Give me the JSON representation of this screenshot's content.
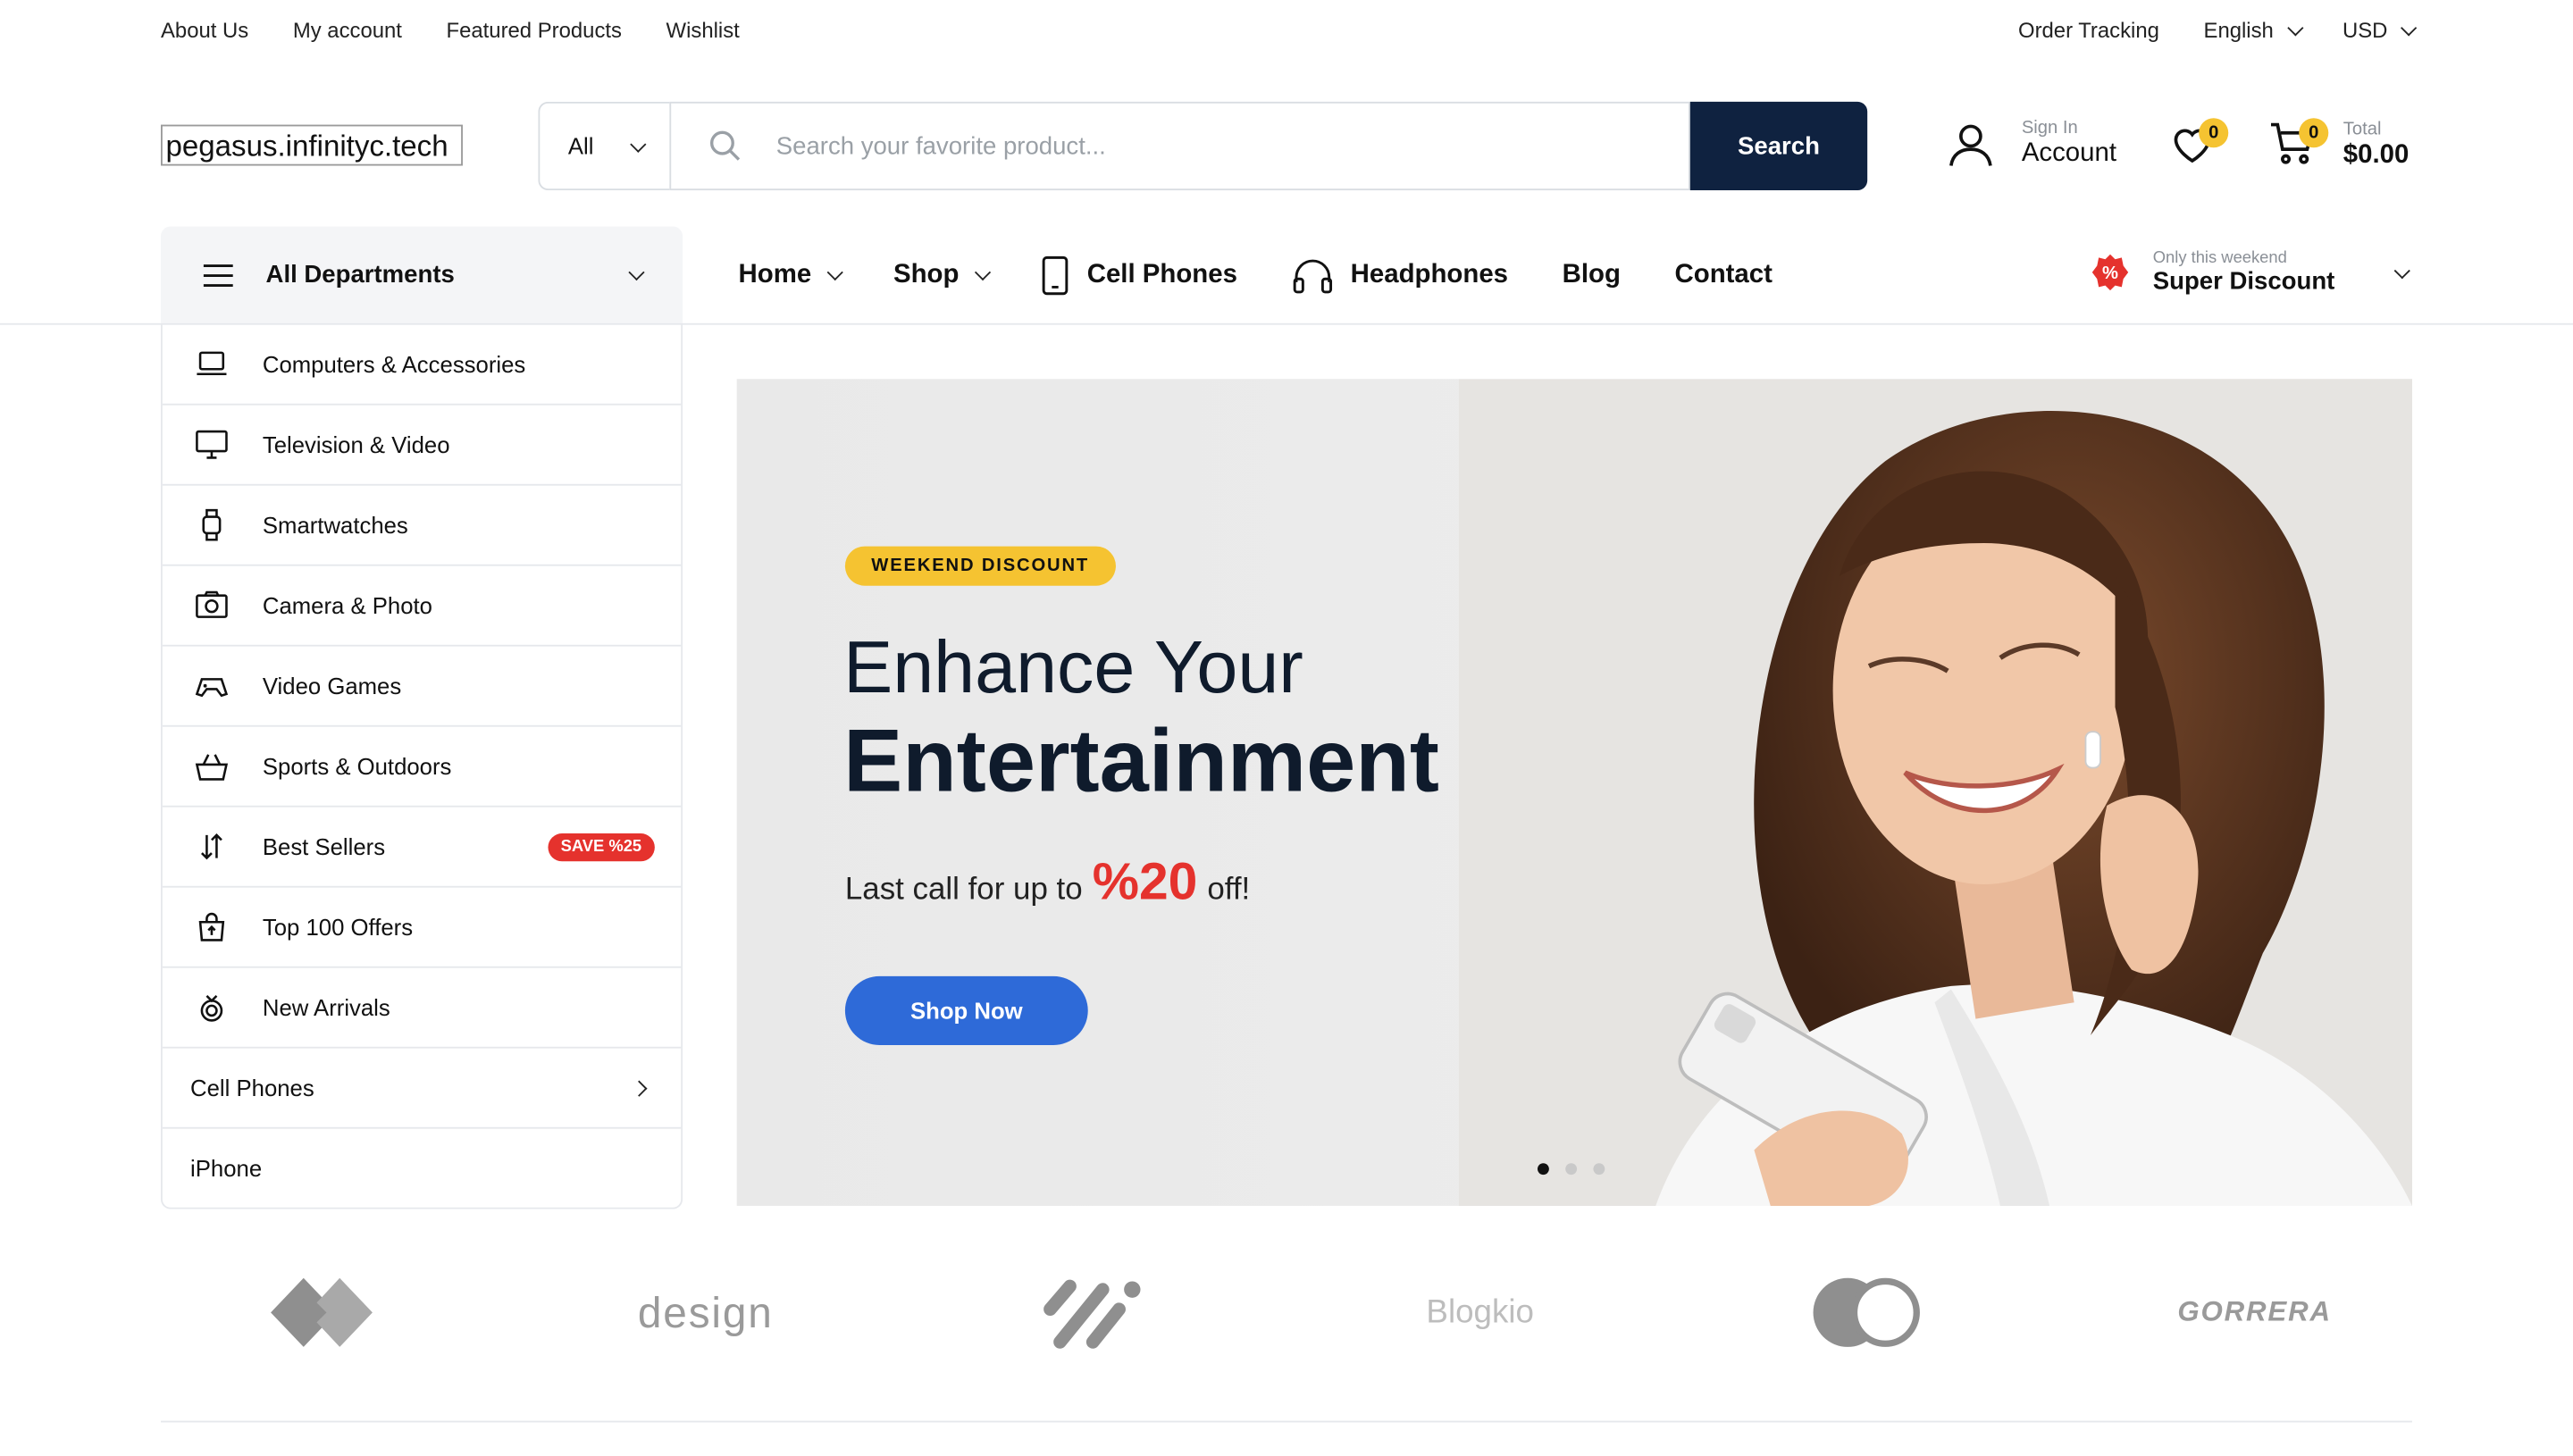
{
  "topbar": {
    "links": [
      "About Us",
      "My account",
      "Featured Products",
      "Wishlist"
    ],
    "order_tracking": "Order Tracking",
    "language": "English",
    "currency": "USD"
  },
  "header": {
    "logo_text": "pegasus.infinityc.tech",
    "search": {
      "category": "All",
      "placeholder": "Search your favorite product...",
      "button": "Search"
    },
    "account": {
      "small": "Sign In",
      "big": "Account"
    },
    "wishlist_count": "0",
    "cart": {
      "count": "0",
      "small": "Total",
      "big": "$0.00"
    }
  },
  "nav": {
    "departments_label": "All Departments",
    "items": [
      {
        "label": "Home",
        "dropdown": true
      },
      {
        "label": "Shop",
        "dropdown": true
      },
      {
        "label": "Cell Phones",
        "icon": "phone-icon"
      },
      {
        "label": "Headphones",
        "icon": "headphones-icon"
      },
      {
        "label": "Blog"
      },
      {
        "label": "Contact"
      }
    ],
    "promo": {
      "small": "Only this weekend",
      "big": "Super Discount"
    }
  },
  "departments": [
    {
      "label": "Computers & Accessories",
      "icon": "laptop-icon"
    },
    {
      "label": "Television & Video",
      "icon": "monitor-icon"
    },
    {
      "label": "Smartwatches",
      "icon": "watch-icon"
    },
    {
      "label": "Camera & Photo",
      "icon": "camera-icon"
    },
    {
      "label": "Video Games",
      "icon": "gamepad-icon"
    },
    {
      "label": "Sports & Outdoors",
      "icon": "basket-icon"
    },
    {
      "label": "Best Sellers",
      "icon": "sort-icon",
      "badge": "SAVE %25"
    },
    {
      "label": "Top 100 Offers",
      "icon": "bag-icon"
    },
    {
      "label": "New Arrivals",
      "icon": "ring-icon"
    },
    {
      "label": "Cell Phones",
      "arrow": true
    },
    {
      "label": "iPhone"
    }
  ],
  "hero": {
    "tag": "WEEKEND DISCOUNT",
    "line1": "Enhance Your",
    "line2": "Entertainment",
    "sub_pre": "Last call for up to",
    "sub_pct": "%20",
    "sub_post": "off!",
    "button": "Shop Now",
    "slides": 3,
    "active_slide": 1
  },
  "brands": [
    "diamond-logo",
    "design",
    "slash-logo",
    "Blogkio",
    "circles-logo",
    "GORRERA"
  ],
  "colors": {
    "navy": "#0f2240",
    "accent_yellow": "#f5c331",
    "sale_red": "#e5322d",
    "button_blue": "#2e6ad8"
  }
}
